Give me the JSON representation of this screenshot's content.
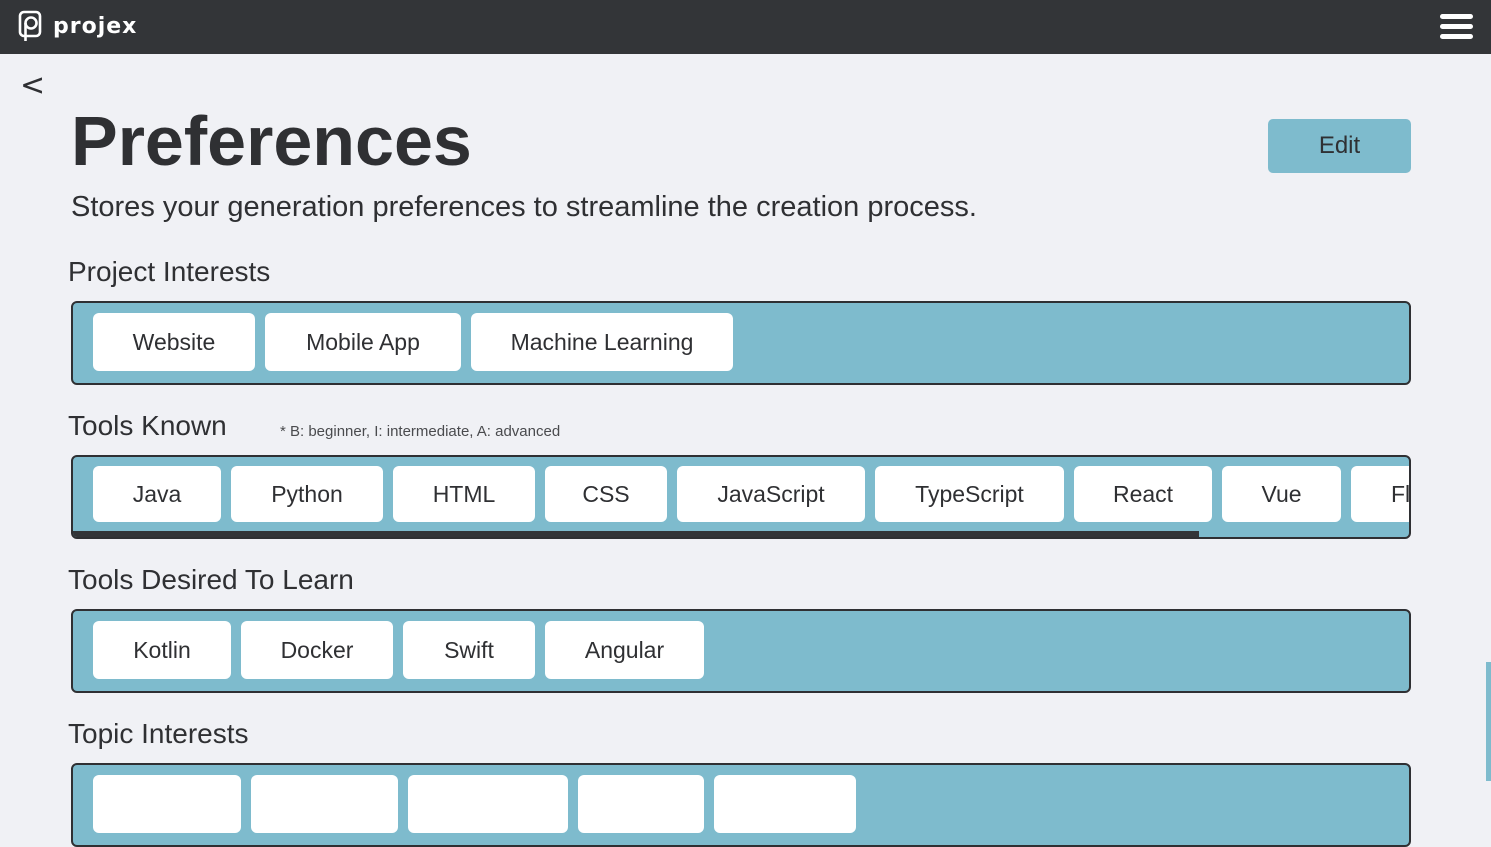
{
  "app": {
    "brand": "projex"
  },
  "nav": {
    "back_label": "<"
  },
  "header": {
    "title": "Preferences",
    "subtitle": "Stores your generation preferences to streamline the creation process.",
    "edit_label": "Edit"
  },
  "sections": {
    "project_interests": {
      "title": "Project Interests",
      "items": [
        "Website",
        "Mobile App",
        "Machine Learning"
      ]
    },
    "tools_known": {
      "title": "Tools Known",
      "note": "* B: beginner, I: intermediate, A: advanced",
      "items": [
        "Java",
        "Python",
        "HTML",
        "CSS",
        "JavaScript",
        "TypeScript",
        "React",
        "Vue",
        "Fl"
      ]
    },
    "tools_desired": {
      "title": "Tools Desired To Learn",
      "items": [
        "Kotlin",
        "Docker",
        "Swift",
        "Angular"
      ]
    },
    "topic_interests": {
      "title": "Topic Interests"
    }
  },
  "colors": {
    "topbar": "#333538",
    "accent": "#7ebbcd",
    "background": "#f0f1f5",
    "text": "#2f3033"
  },
  "icons": {
    "logo": "projex-logo-icon",
    "menu": "hamburger-menu-icon"
  }
}
